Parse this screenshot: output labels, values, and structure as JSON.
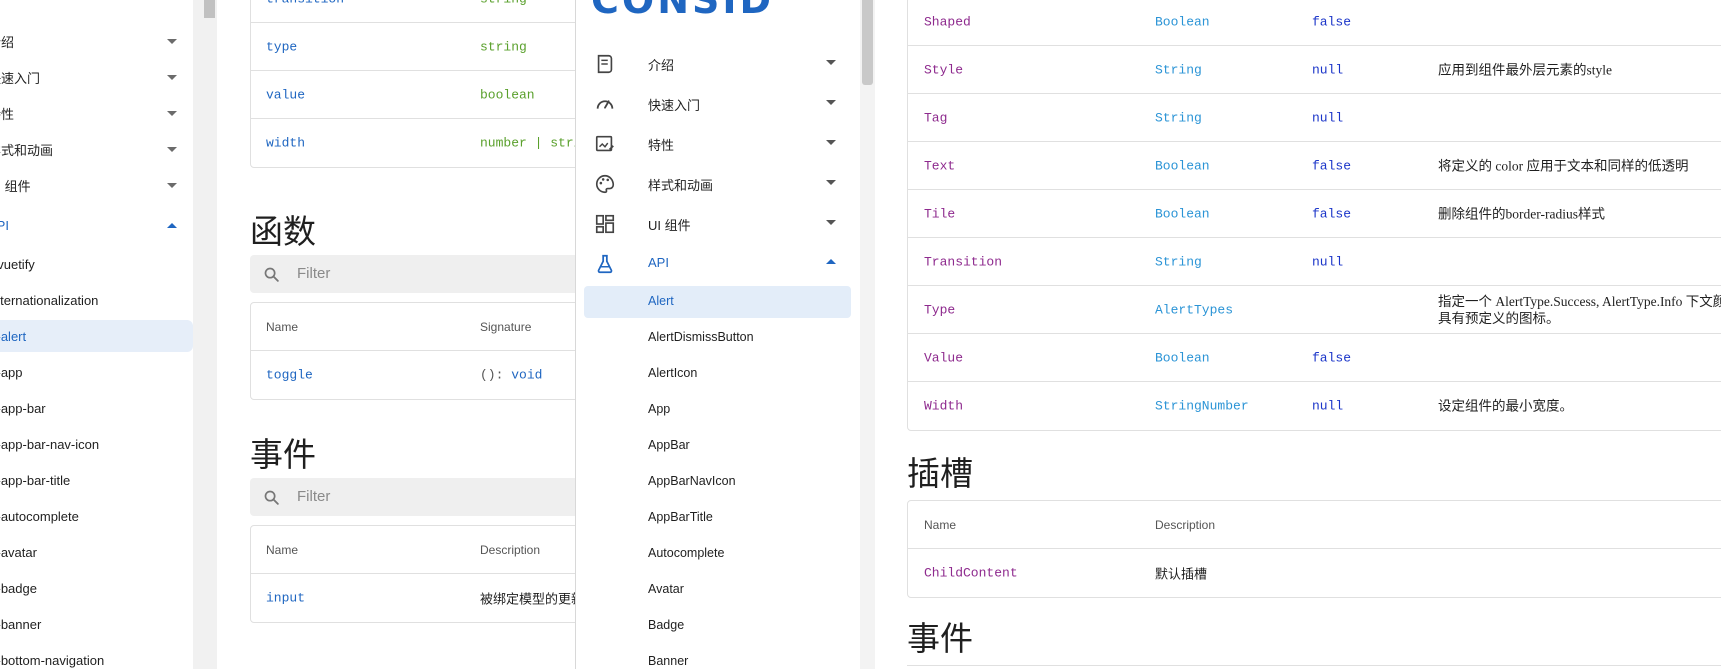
{
  "left_nav": {
    "groups": [
      {
        "label": "介绍",
        "expanded": false
      },
      {
        "label": "快速入门",
        "expanded": false
      },
      {
        "label": "特性",
        "expanded": false
      },
      {
        "label": "样式和动画",
        "expanded": false
      },
      {
        "label": "UI 组件",
        "expanded": false
      },
      {
        "label": "API",
        "expanded": true
      }
    ],
    "items": [
      "$vuetify",
      "internationalization",
      "v-alert",
      "v-app",
      "v-app-bar",
      "v-app-bar-nav-icon",
      "v-app-bar-title",
      "v-autocomplete",
      "v-avatar",
      "v-badge",
      "v-banner",
      "v-bottom-navigation"
    ],
    "active_item": "v-alert"
  },
  "left_main": {
    "props_rows": [
      {
        "name": "transition",
        "type": "string"
      },
      {
        "name": "type",
        "type": "string"
      },
      {
        "name": "value",
        "type": "boolean"
      },
      {
        "name": "width",
        "type": "number | string"
      }
    ],
    "functions_title": "函数",
    "functions_filter_placeholder": "Filter",
    "functions_headers": {
      "name": "Name",
      "signature": "Signature"
    },
    "functions_rows": [
      {
        "name": "toggle",
        "signature_paren": "():",
        "signature_type": "void"
      }
    ],
    "events_title": "事件",
    "events_filter_placeholder": "Filter",
    "events_headers": {
      "name": "Name",
      "description": "Description"
    },
    "events_rows": [
      {
        "name": "input",
        "description": "被绑定模型的更新"
      }
    ]
  },
  "mid_panel": {
    "logo": "CONSID",
    "groups": [
      {
        "label": "介绍",
        "icon": "book-icon",
        "expanded": false
      },
      {
        "label": "快速入门",
        "icon": "speedometer-icon",
        "expanded": false
      },
      {
        "label": "特性",
        "icon": "image-edit-icon",
        "expanded": false
      },
      {
        "label": "样式和动画",
        "icon": "palette-icon",
        "expanded": false
      },
      {
        "label": "UI 组件",
        "icon": "view-dashboard-icon",
        "expanded": false
      },
      {
        "label": "API",
        "icon": "flask-icon",
        "expanded": true
      }
    ],
    "items": [
      "Alert",
      "AlertDismissButton",
      "AlertIcon",
      "App",
      "AppBar",
      "AppBarNavIcon",
      "AppBarTitle",
      "Autocomplete",
      "Avatar",
      "Badge",
      "Banner"
    ],
    "active_item": "Alert"
  },
  "right_main": {
    "props_rows": [
      {
        "name": "Shaped",
        "type": "Boolean",
        "default": "false",
        "desc": ""
      },
      {
        "name": "Style",
        "type": "String",
        "default": "null",
        "desc": "应用到组件最外层元素的style"
      },
      {
        "name": "Tag",
        "type": "String",
        "default": "null",
        "desc": ""
      },
      {
        "name": "Text",
        "type": "Boolean",
        "default": "false",
        "desc": "将定义的 color 应用于文本和同样的低透明"
      },
      {
        "name": "Tile",
        "type": "Boolean",
        "default": "false",
        "desc": "删除组件的border-radius样式"
      },
      {
        "name": "Transition",
        "type": "String",
        "default": "null",
        "desc": ""
      },
      {
        "name": "Type",
        "type": "AlertTypes",
        "default": "",
        "desc": "指定一个 AlertType.Success, AlertType.Info 下文颜色并具有预定义的图标。"
      },
      {
        "name": "Value",
        "type": "Boolean",
        "default": "false",
        "desc": ""
      },
      {
        "name": "Width",
        "type": "StringNumber",
        "default": "null",
        "desc": "设定组件的最小宽度。"
      }
    ],
    "slots_title": "插槽",
    "slots_headers": {
      "name": "Name",
      "description": "Description"
    },
    "slots_rows": [
      {
        "name": "ChildContent",
        "description": "默认插槽"
      }
    ],
    "events_title": "事件"
  },
  "colors": {
    "primary": "#1f66c1",
    "active_bg": "#e6eef9",
    "prop_name_purple": "#8e2a8e",
    "type_blue": "#2b94d6",
    "default_blue": "#1b35c9",
    "vuetify_type_green": "#5aa02c"
  }
}
